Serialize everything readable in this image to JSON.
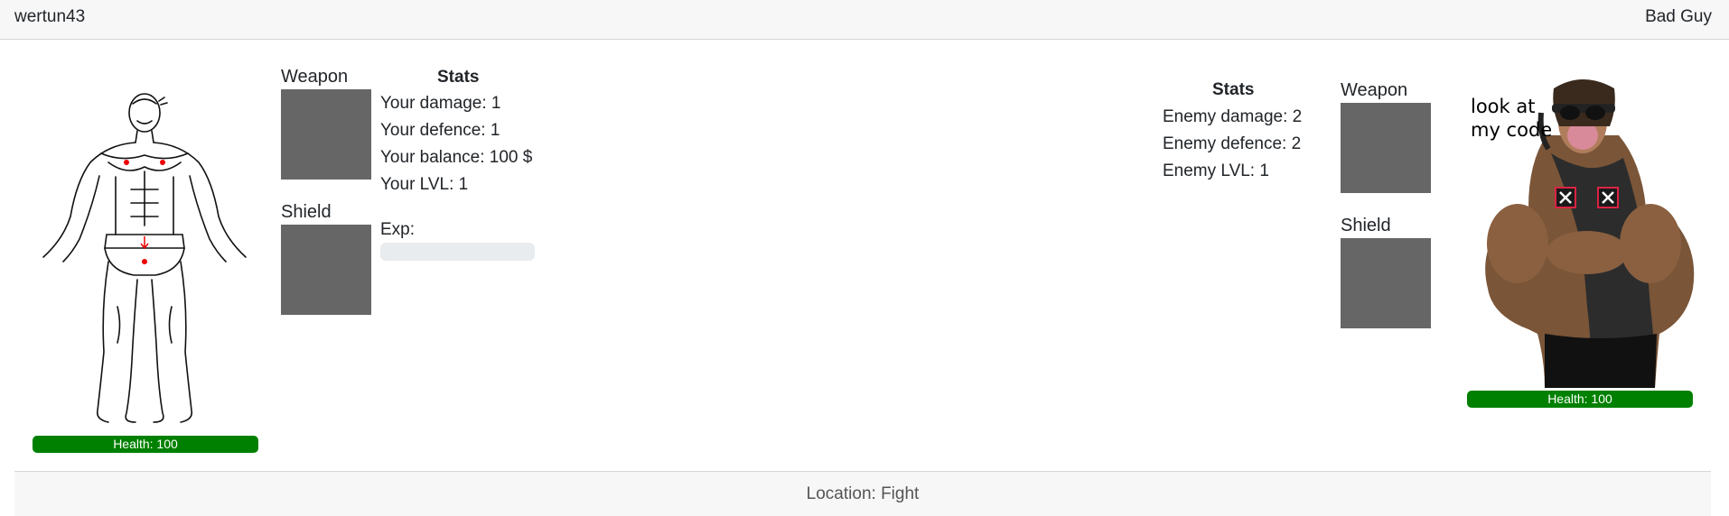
{
  "header": {
    "username": "wertun43",
    "enemy_name": "Bad Guy"
  },
  "player": {
    "weapon_label": "Weapon",
    "shield_label": "Shield",
    "stats_title": "Stats",
    "damage": "Your damage: 1",
    "defence": "Your defence: 1",
    "balance": "Your balance: 100 $",
    "lvl": "Your LVL: 1",
    "exp_label": "Exp:",
    "exp_progress": 0,
    "health": "Health: 100"
  },
  "enemy": {
    "stats_title": "Stats",
    "damage": "Enemy damage: 2",
    "defence": "Enemy defence: 2",
    "lvl": "Enemy LVL: 1",
    "weapon_label": "Weapon",
    "shield_label": "Shield",
    "health": "Health: 100",
    "image_caption": "look at\nmy code"
  },
  "footer": {
    "location": "Location: Fight"
  },
  "colors": {
    "health_bar": "#008000",
    "slot": "#666666",
    "topbar": "#f7f7f7"
  },
  "icons": {
    "player": "bodybuilder-sketch-icon",
    "enemy": "muscular-enemy-icon",
    "broken_image": "broken-image-icon"
  }
}
